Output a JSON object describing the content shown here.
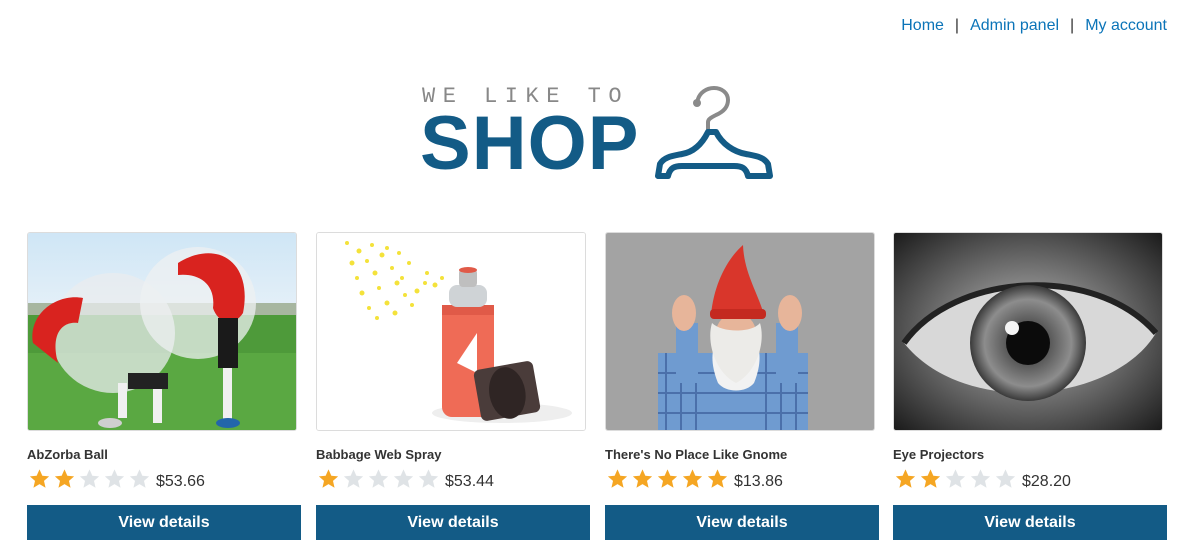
{
  "nav": {
    "items": [
      {
        "label": "Home"
      },
      {
        "label": "Admin panel"
      },
      {
        "label": "My account"
      }
    ],
    "separator": "|"
  },
  "logo": {
    "tagline": "WE LIKE TO",
    "brand": "SHOP",
    "icon": "hanger-icon"
  },
  "colors": {
    "brand": "#135b86",
    "link": "#0b74b8",
    "star_filled": "#f5a623",
    "star_empty": "#dfe3e6",
    "button_text": "#ffffff"
  },
  "products": [
    {
      "title": "AbZorba Ball",
      "rating": 2,
      "max_rating": 5,
      "price": "$53.66",
      "button": "View details",
      "image": "inflatable-bubble-ball-photo"
    },
    {
      "title": "Babbage Web Spray",
      "rating": 1,
      "max_rating": 5,
      "price": "$53.44",
      "button": "View details",
      "image": "spray-can-photo"
    },
    {
      "title": "There's No Place Like Gnome",
      "rating": 5,
      "max_rating": 5,
      "price": "$13.86",
      "button": "View details",
      "image": "gnome-costume-photo"
    },
    {
      "title": "Eye Projectors",
      "rating": 2,
      "max_rating": 5,
      "price": "$28.20",
      "button": "View details",
      "image": "eye-closeup-photo"
    }
  ]
}
